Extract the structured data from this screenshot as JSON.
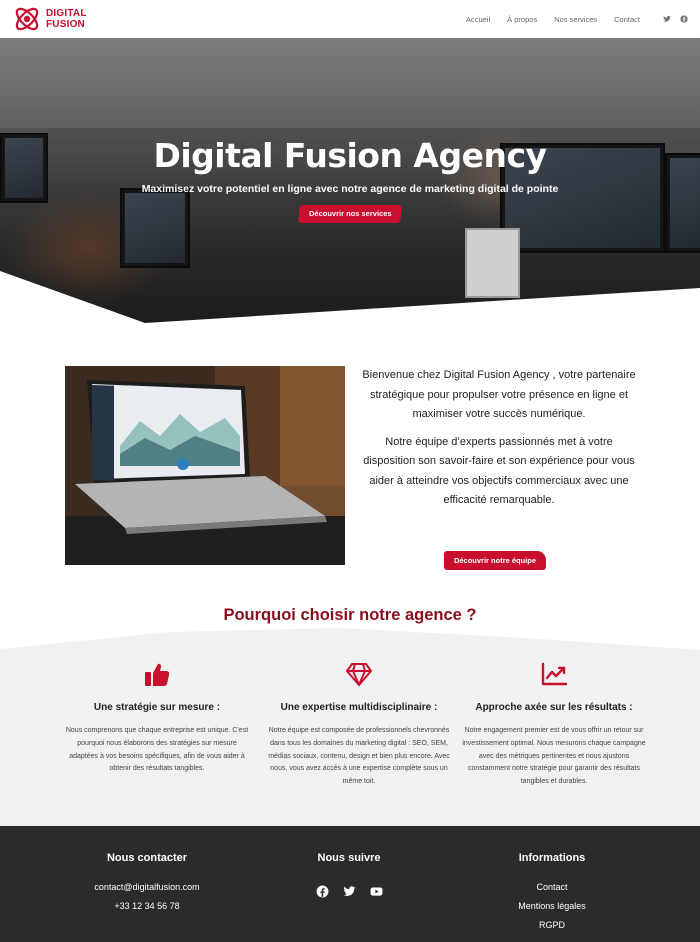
{
  "brand": {
    "line1": "DIGITAL",
    "line2": "FUSION",
    "accent": "#c8102e"
  },
  "nav": {
    "items": [
      "Accueil",
      "À propos",
      "Nos services",
      "Contact"
    ],
    "social": [
      "twitter-icon",
      "facebook-icon"
    ]
  },
  "hero": {
    "title": "Digital Fusion Agency",
    "subtitle": "Maximisez votre potentiel en ligne avec notre agence de marketing digital de pointe",
    "cta": "Découvrir nos services"
  },
  "intro": {
    "paragraph1": "Bienvenue chez Digital Fusion Agency , votre partenaire stratégique pour propulser votre présence en ligne et maximiser votre succès numérique.",
    "paragraph2": "Notre équipe d’experts passionnés met à votre disposition son savoir-faire et son expérience pour vous aider à atteindre vos objectifs commerciaux avec une efficacité remarquable.",
    "cta": "Découvrir notre équipe"
  },
  "why": {
    "title": "Pourquoi choisir notre agence ?",
    "features": [
      {
        "icon": "thumbs-up-icon",
        "title": "Une stratégie sur mesure :",
        "text": "Nous comprenons que chaque entreprise est unique. C'est pourquoi nous élaborons des stratégies sur mesure adaptées à vos besoins spécifiques, afin de vous aider à obtenir des résultats tangibles."
      },
      {
        "icon": "diamond-icon",
        "title": "Une expertise multidisciplinaire :",
        "text": "Notre équipe est composée de professionnels chevronnés dans tous les domaines du marketing digital : SEO, SEM, médias sociaux, contenu, design et bien plus encore. Avec nous, vous avez accès à une expertise complète sous un même toit."
      },
      {
        "icon": "chart-line-icon",
        "title": "Approche axée sur les résultats :",
        "text": "Notre engagement premier est de vous offrir un retour sur investissement optimal. Nous mesurons chaque campagne avec des métriques pertinentes et nous ajustons constamment notre stratégie pour garantir des résultats tangibles et durables."
      }
    ]
  },
  "footer": {
    "contact": {
      "title": "Nous contacter",
      "email": "contact@digitalfusion.com",
      "phone": "+33 12 34 56 78"
    },
    "follow": {
      "title": "Nous suivre",
      "icons": [
        "facebook-icon",
        "twitter-icon",
        "youtube-icon"
      ]
    },
    "info": {
      "title": "Informations",
      "links": [
        "Contact",
        "Mentions légales",
        "RGPD"
      ]
    }
  }
}
